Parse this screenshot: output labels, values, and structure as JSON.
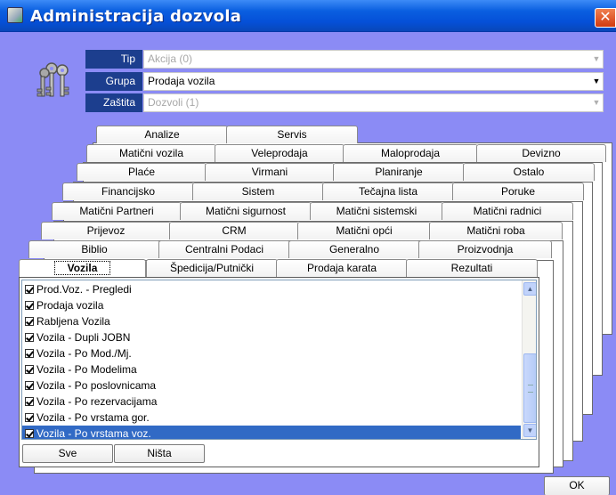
{
  "window": {
    "title": "Administracija dozvola",
    "close_glyph": "✕"
  },
  "header": {
    "fields": [
      {
        "label": "Tip",
        "value": "Akcija (0)",
        "disabled": true
      },
      {
        "label": "Grupa",
        "value": "Prodaja vozila",
        "disabled": false
      },
      {
        "label": "Zaštita",
        "value": "Dozvoli (1)",
        "disabled": true
      }
    ]
  },
  "tabs": {
    "row1": [
      "Analize",
      "Servis"
    ],
    "row2": [
      "Matični vozila",
      "Veleprodaja",
      "Maloprodaja",
      "Devizno"
    ],
    "row3": [
      "Plaće",
      "Virmani",
      "Planiranje",
      "Ostalo"
    ],
    "row4": [
      "Financijsko",
      "Sistem",
      "Tečajna lista",
      "Poruke"
    ],
    "row5": [
      "Matični Partneri",
      "Matični sigurnost",
      "Matični sistemski",
      "Matični radnici"
    ],
    "row6": [
      "Prijevoz",
      "CRM",
      "Matični opći",
      "Matični roba"
    ],
    "row7": [
      "Biblio",
      "Centralni Podaci",
      "Generalno",
      "Proizvodnja"
    ],
    "row8": [
      "Vozila",
      "Špedicija/Putnički",
      "Prodaja karata",
      "Rezultati"
    ],
    "active": "Vozila"
  },
  "list": {
    "items": [
      {
        "label": "Prod.Voz. - Pregledi",
        "checked": true
      },
      {
        "label": "Prodaja vozila",
        "checked": true
      },
      {
        "label": "Rabljena Vozila",
        "checked": true
      },
      {
        "label": "Vozila - Dupli JOBN",
        "checked": true
      },
      {
        "label": "Vozila - Po Mod./Mj.",
        "checked": true
      },
      {
        "label": "Vozila - Po Modelima",
        "checked": true
      },
      {
        "label": "Vozila - Po poslovnicama",
        "checked": true
      },
      {
        "label": "Vozila - Po rezervacijama",
        "checked": true
      },
      {
        "label": "Vozila - Po vrstama gor.",
        "checked": true
      },
      {
        "label": "Vozila - Po vrstama voz.",
        "checked": true,
        "selected": true
      }
    ]
  },
  "buttons": {
    "all": "Sve",
    "none": "Ništa",
    "ok": "OK"
  },
  "colors": {
    "background": "#8b8bf5",
    "label_bg": "#1c3e8e",
    "selection": "#316ac5"
  }
}
